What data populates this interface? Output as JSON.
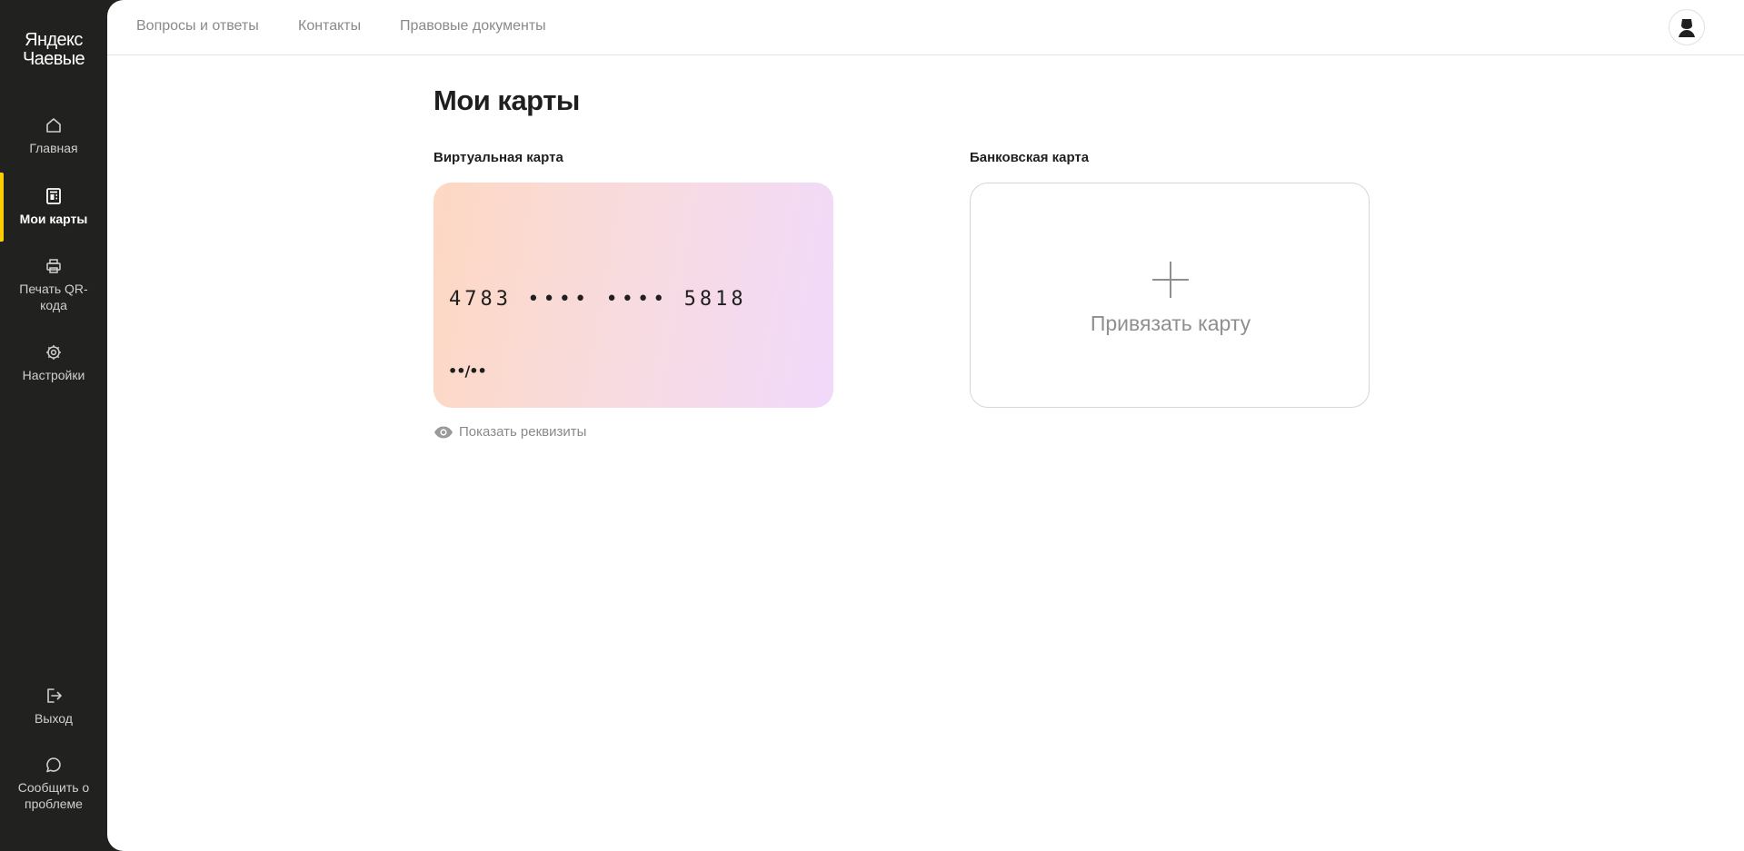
{
  "sidebar": {
    "logo_line1": "Яндекс",
    "logo_line2": "Чаевые",
    "items": [
      {
        "label": "Главная",
        "icon": "home-icon"
      },
      {
        "label": "Мои карты",
        "icon": "card-icon",
        "active": true
      },
      {
        "label": "Печать QR-кода",
        "icon": "printer-icon"
      },
      {
        "label": "Настройки",
        "icon": "gear-icon"
      }
    ],
    "bottom_items": [
      {
        "label": "Выход",
        "icon": "logout-icon"
      },
      {
        "label": "Сообщить о проблеме",
        "icon": "chat-bubble-icon"
      }
    ],
    "accent_color": "#ffcc00"
  },
  "header": {
    "links": [
      "Вопросы и ответы",
      "Контакты",
      "Правовые документы"
    ],
    "avatar_icon": "user-avatar-icon"
  },
  "main": {
    "title": "Мои карты",
    "virtual_card": {
      "label": "Виртуальная карта",
      "number": "4783 •••• •••• 5818",
      "expiry": "••/••",
      "show_details": "Показать реквизиты"
    },
    "bank_card": {
      "label": "Банковская карта",
      "add_label": "Привязать карту"
    }
  }
}
